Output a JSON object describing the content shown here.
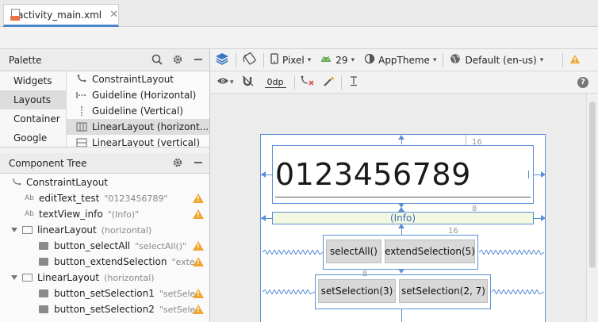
{
  "file_tab": {
    "name": "activity_main.xml",
    "close_glyph": "✕"
  },
  "palette": {
    "title": "Palette",
    "categories": [
      "Widgets",
      "Layouts",
      "Container",
      "Google"
    ],
    "selected_category": "Layouts",
    "items": [
      {
        "label": "ConstraintLayout",
        "icon": "constraint-layout-icon"
      },
      {
        "label": "Guideline (Horizontal)",
        "icon": "guideline-horizontal-icon"
      },
      {
        "label": "Guideline (Vertical)",
        "icon": "guideline-vertical-icon"
      },
      {
        "label": "LinearLayout (horizont...",
        "icon": "linear-layout-horizontal-icon"
      },
      {
        "label": "LinearLayout (vertical)",
        "icon": "linear-layout-vertical-icon"
      }
    ]
  },
  "component_tree": {
    "title": "Component Tree",
    "rows": [
      {
        "label": "ConstraintLayout",
        "sub": "",
        "warn": false
      },
      {
        "label": "editText_test",
        "sub": "\"0123456789\"",
        "warn": true
      },
      {
        "label": "textView_info",
        "sub": "\"(Info)\"",
        "warn": true
      },
      {
        "label": "linearLayout",
        "sub": "(horizontal)",
        "warn": false
      },
      {
        "label": "button_selectAll",
        "sub": "\"selectAll()\"",
        "warn": true
      },
      {
        "label": "button_extendSelection",
        "sub": "\"exte...",
        "warn": true
      },
      {
        "label": "LinearLayout",
        "sub": "(horizontal)",
        "warn": false
      },
      {
        "label": "button_setSelection1",
        "sub": "\"setSele...",
        "warn": true
      },
      {
        "label": "button_setSelection2",
        "sub": "\"setSele...",
        "warn": true
      }
    ]
  },
  "toolbar": {
    "device": "Pixel",
    "api": "29",
    "theme": "AppTheme",
    "locale": "Default (en-us)",
    "margin": "0dp",
    "help": "?"
  },
  "canvas": {
    "edit_text": "0123456789",
    "info_text": "(Info)",
    "dims": [
      "16",
      "8",
      "16",
      "8"
    ],
    "buttons": {
      "select_all": "selectAll()",
      "extend_selection": "extendSelection(5)",
      "set_selection_1": "setSelection(3)",
      "set_selection_2": "setSelection(2, 7)"
    }
  },
  "colors": {
    "accent": "#4a86c8",
    "warning": "#f0a732",
    "constraint": "#5a8fd6"
  }
}
